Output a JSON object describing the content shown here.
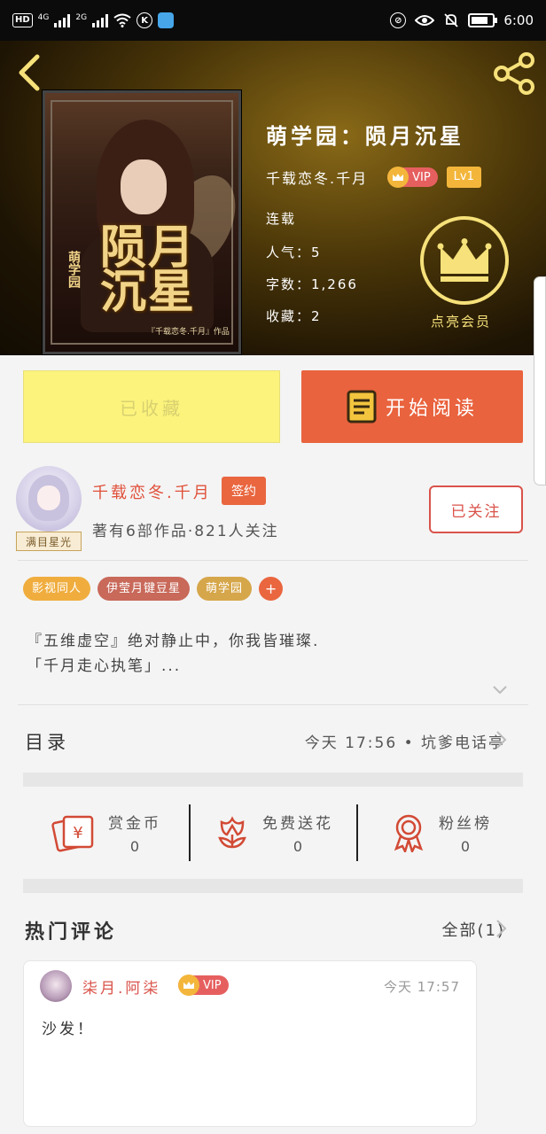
{
  "status_bar": {
    "left_hd": "HD",
    "left_4g": "4G",
    "left_2g": "2G",
    "nfc_icon": "k-circle-icon",
    "time": "6:00"
  },
  "book": {
    "title": "萌学园：陨月沉星",
    "author": "千载恋冬.千月",
    "vip_label": "VIP",
    "level": "Lv1",
    "status": "连载",
    "popularity_label": "人气：5",
    "word_count_label": "字数：1,266",
    "favorites_label": "收藏：2",
    "member_label": "点亮会员",
    "cover": {
      "title": "陨月沉星",
      "series": "萌学园",
      "credit": "『千载恋冬.千月』作品"
    }
  },
  "actions": {
    "collected_label": "已收藏",
    "read_label": "开始阅读"
  },
  "author": {
    "name": "千载恋冬.千月",
    "badge": "签约",
    "avatar_tag": "满目星光",
    "stats": "著有6部作品·821人关注",
    "follow_label": "已关注"
  },
  "tags": [
    {
      "label": "影视同人",
      "color": "#f0ad3e"
    },
    {
      "label": "伊莹月键豆星",
      "color": "#c8695a"
    },
    {
      "label": "萌学园",
      "color": "#d6a64a"
    }
  ],
  "tag_add": "+",
  "intro": {
    "line1": "『五维虚空』绝对静止中，你我皆璀璨.",
    "line2": "「千月走心执笔」..."
  },
  "toc": {
    "label": "目录",
    "latest": "今天 17:56 • 坑爹电话亭"
  },
  "rewards": [
    {
      "label": "赏金币",
      "value": "0",
      "icon": "red-envelope-icon"
    },
    {
      "label": "免费送花",
      "value": "0",
      "icon": "flower-icon"
    },
    {
      "label": "粉丝榜",
      "value": "0",
      "icon": "medal-icon"
    }
  ],
  "comments": {
    "section_label": "热门评论",
    "all_label": "全部(1)",
    "items": [
      {
        "user": "柒月.阿柒",
        "vip_label": "VIP",
        "time": "今天 17:57",
        "text": "沙发！"
      }
    ]
  },
  "colors": {
    "accent": "#e9633e",
    "collected_bg": "#fbf37c",
    "gold": "#f6e17a",
    "vip_red": "#e65f5f"
  }
}
